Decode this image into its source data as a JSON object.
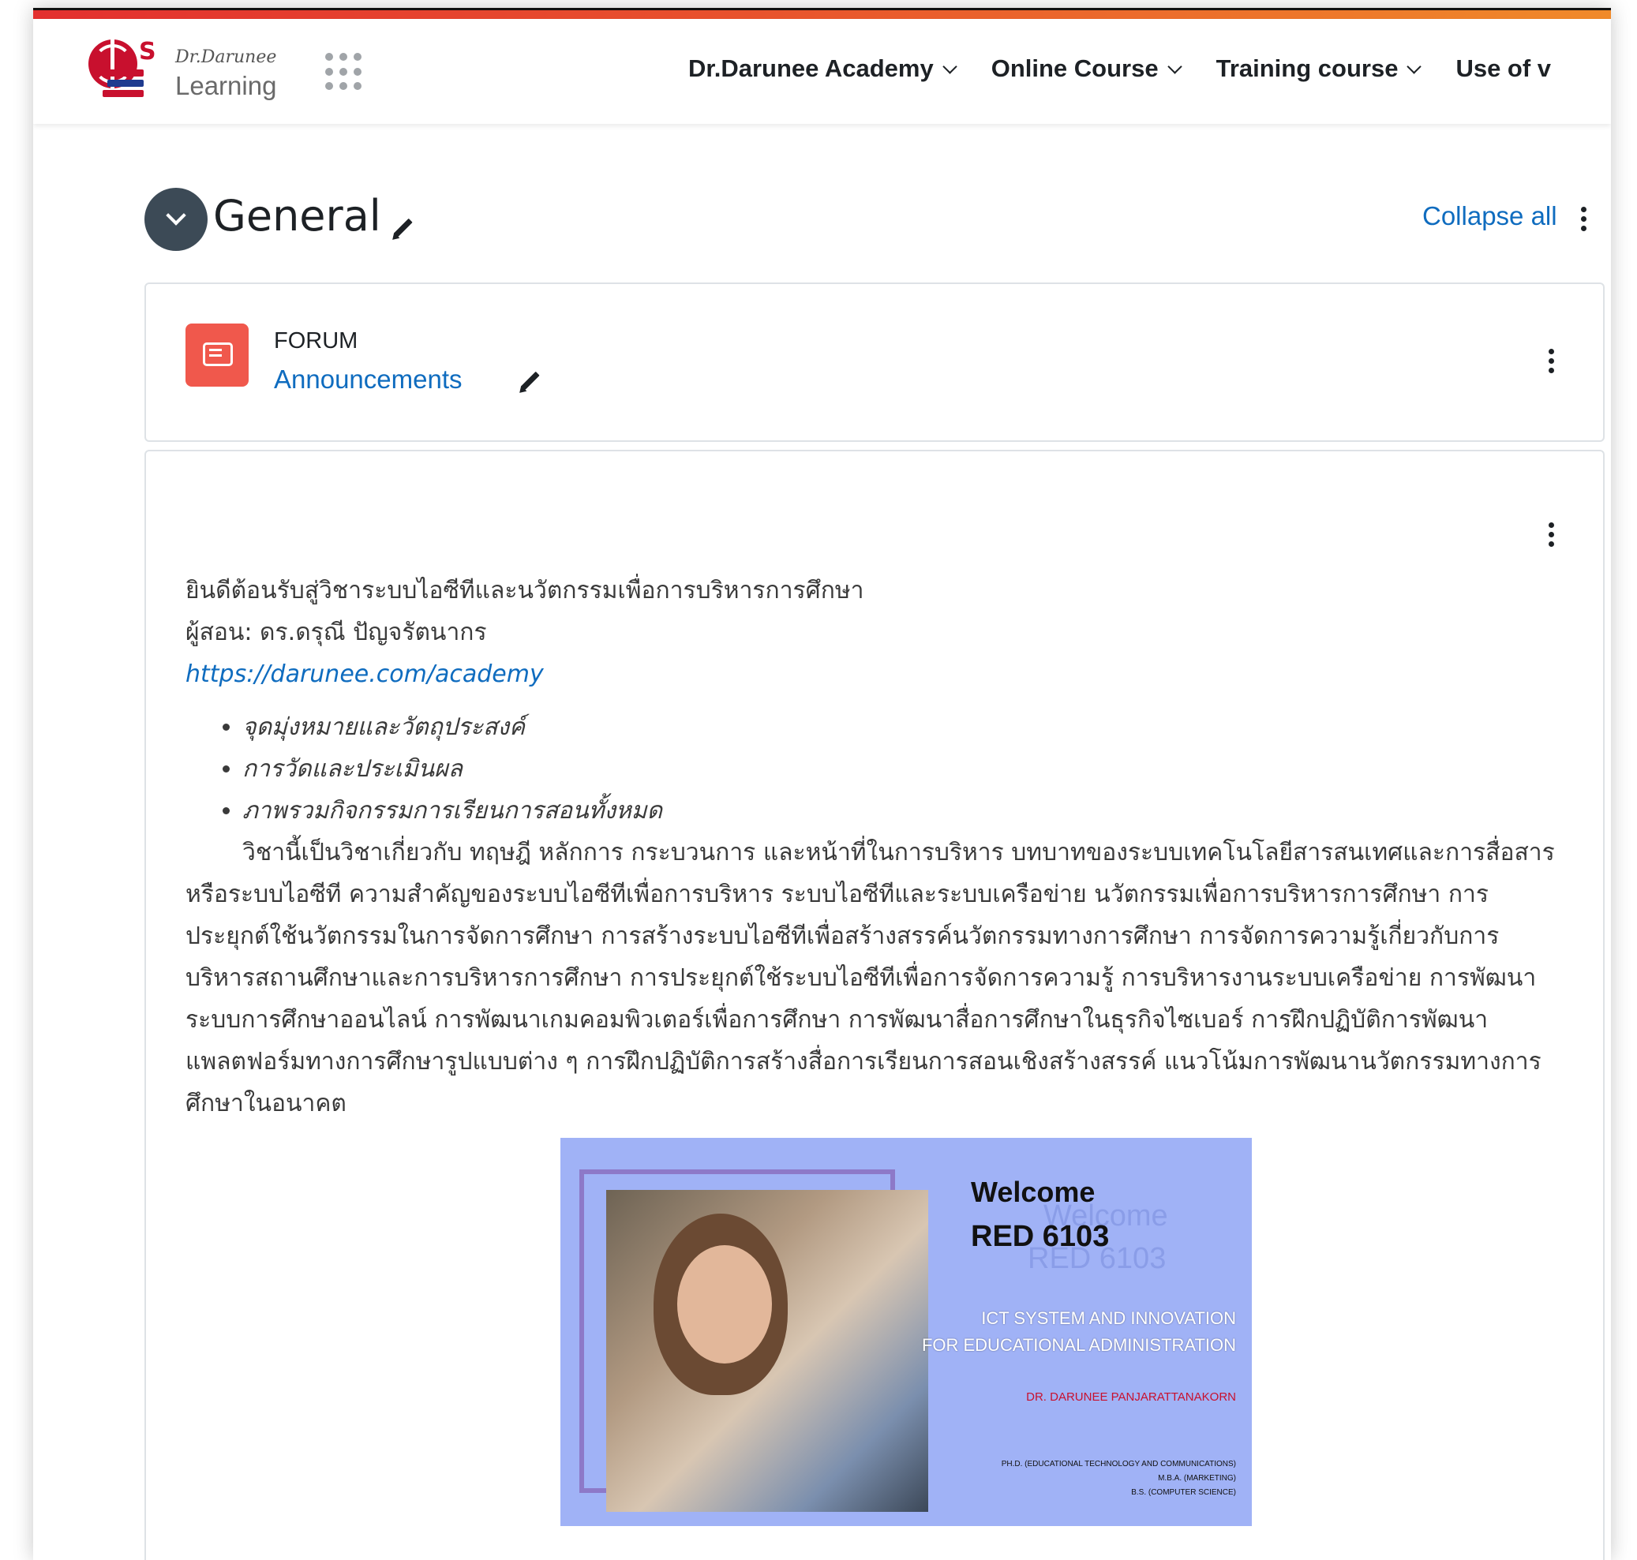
{
  "colors": {
    "accent": "#0f6cbf",
    "forum_icon": "#f0584c",
    "toggle": "#3c4a56",
    "banner_bg": "#a0b2f6"
  },
  "header": {
    "logo": {
      "script_text": "Dr.Darunee",
      "name": "Learning"
    },
    "nav": [
      {
        "label": "Dr.Darunee Academy"
      },
      {
        "label": "Online Course"
      },
      {
        "label": "Training course"
      },
      {
        "label": "Use of v"
      }
    ]
  },
  "section": {
    "title": "General",
    "collapse_all": "Collapse all"
  },
  "forum": {
    "type": "FORUM",
    "name": "Announcements",
    "icon": "forum-icon"
  },
  "label": {
    "welcome": "ยินดีต้อนรับสู่วิชาระบบไอซีทีและนวัตกรรมเพื่อการบริหารการศึกษา",
    "instructor": "ผู้สอน: ดร.ดรุณี ปัญจรัตนากร",
    "url": "https://darunee.com/academy",
    "bullets": [
      "จุดมุ่งหมายและวัตถุประสงค์",
      "การวัดและประเมินผล",
      "ภาพรวมกิจกรรมการเรียนการสอนทั้งหมด"
    ],
    "description": "วิชานี้เป็นวิชาเกี่ยวกับ ทฤษฎี หลักการ กระบวนการ และหน้าที่ในการบริหาร บทบาทของระบบเทคโนโลยีสารสนเทศและการสื่อสารหรือระบบไอซีที ความสำคัญของระบบไอซีทีเพื่อการบริหาร ระบบไอซีทีและระบบเครือข่าย นวัตกรรมเพื่อการบริหารการศึกษา การประยุกต์ใช้นวัตกรรมในการจัดการศึกษา การสร้างระบบไอซีทีเพื่อสร้างสรรค์นวัตกรรมทางการศึกษา การจัดการความรู้เกี่ยวกับการบริหารสถานศึกษาและการบริหารการศึกษา การประยุกต์ใช้ระบบไอซีทีเพื่อการจัดการความรู้ การบริหารงานระบบเครือข่าย การพัฒนาระบบการศึกษาออนไลน์ การพัฒนาเกมคอมพิวเตอร์เพื่อการศึกษา การพัฒนาสื่อการศึกษาในธุรกิจไซเบอร์ การฝึกปฏิบัติการพัฒนาแพลตฟอร์มทางการศึกษารูปแบบต่าง ๆ การฝึกปฏิบัติการสร้างสื่อการเรียนการสอนเชิงสร้างสรรค์ แนวโน้มการพัฒนานวัตกรรมทางการศึกษาในอนาคต"
  },
  "banner": {
    "welcome": "Welcome",
    "code": "RED 6103",
    "ghost_welcome": "Welcome",
    "ghost_code": "RED 6103",
    "line1": "ICT SYSTEM AND INNOVATION",
    "line2": "FOR EDUCATIONAL ADMINISTRATION",
    "author": "DR. DARUNEE PANJARATTANAKORN",
    "degrees": [
      "PH.D. (EDUCATIONAL TECHNOLOGY AND COMMUNICATIONS)",
      "M.B.A. (MARKETING)",
      "B.S. (COMPUTER SCIENCE)"
    ]
  }
}
